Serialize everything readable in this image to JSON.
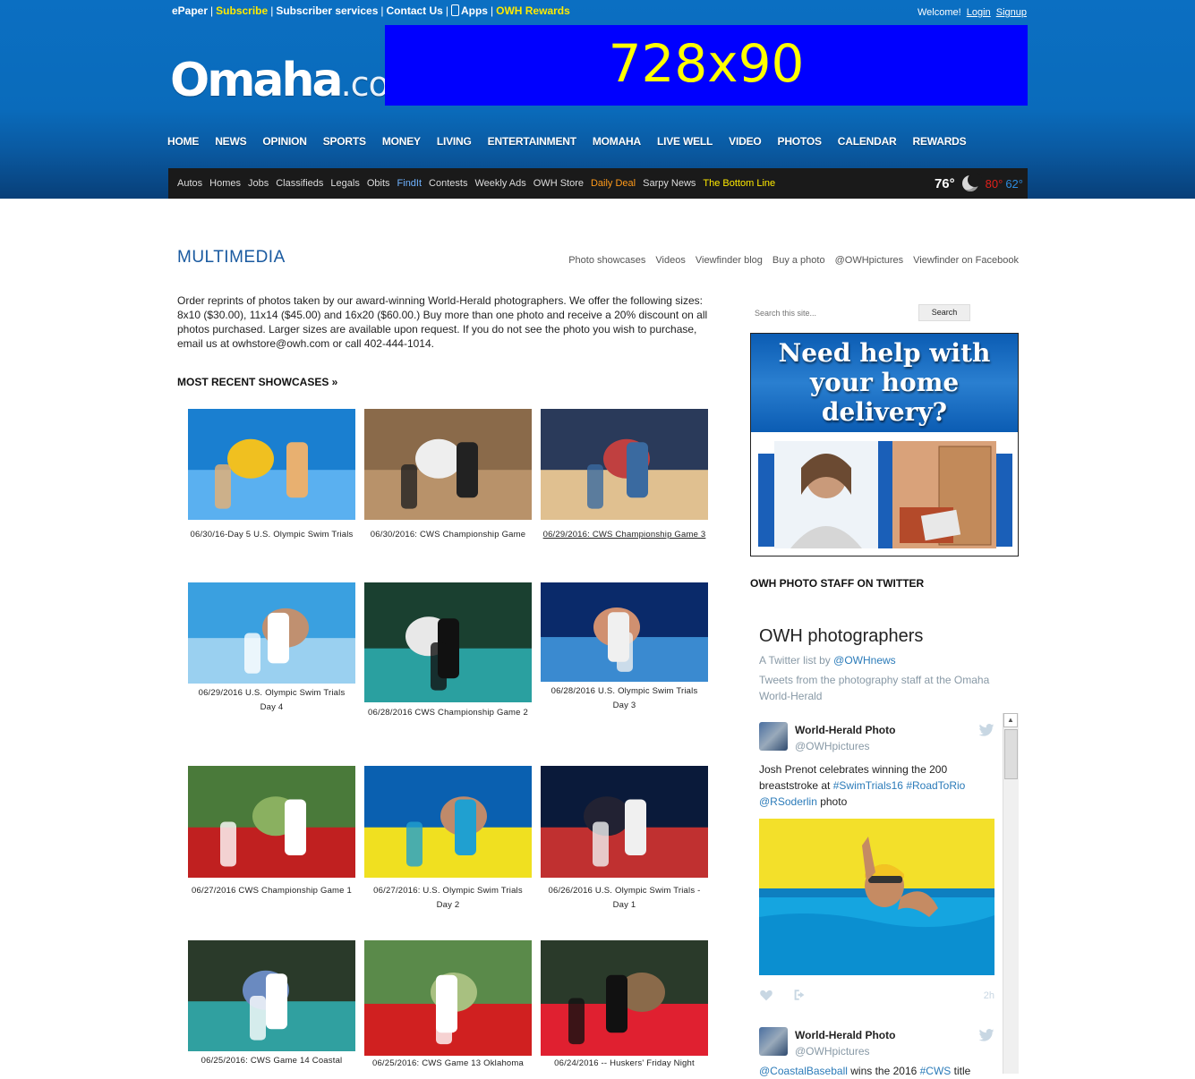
{
  "toplinks": {
    "epaper": "ePaper",
    "subscribe": "Subscribe",
    "subscriber_services": "Subscriber services",
    "contact": "Contact Us",
    "apps": "Apps",
    "rewards": "OWH Rewards"
  },
  "welcome": {
    "text": "Welcome!",
    "login": "Login",
    "signup": "Signup"
  },
  "logo": {
    "main": "Omaha",
    "dom": ".com"
  },
  "ad": {
    "text": "728x90"
  },
  "mainnav": [
    "HOME",
    "NEWS",
    "OPINION",
    "SPORTS",
    "MONEY",
    "LIVING",
    "ENTERTAINMENT",
    "MOMAHA",
    "LIVE WELL",
    "VIDEO",
    "PHOTOS",
    "CALENDAR",
    "REWARDS"
  ],
  "subnav": [
    "Autos",
    "Homes",
    "Jobs",
    "Classifieds",
    "Legals",
    "Obits",
    "FindIt",
    "Contests",
    "Weekly Ads",
    "OWH Store",
    "Daily Deal",
    "Sarpy News",
    "The Bottom Line"
  ],
  "subnav_colors": {
    "FindIt": "#6fb3ff",
    "Daily Deal": "#ff9a1a",
    "The Bottom Line": "#ffea00"
  },
  "weather": {
    "temp": "76°",
    "hi": "80°",
    "lo": "62°"
  },
  "section": {
    "title": "MULTIMEDIA",
    "links": [
      "Photo showcases",
      "Videos",
      "Viewfinder blog",
      "Buy a photo",
      "@OWHpictures",
      "Viewfinder on Facebook"
    ]
  },
  "intro": "Order reprints of photos taken by our award-winning World-Herald photographers. We offer the following sizes: 8x10 ($30.00), 11x14 ($45.00) and 16x20 ($60.00.) Buy more than one photo and receive a 20% discount on all photos purchased. Larger sizes are available upon request. If you do not see the photo you wish to purchase, email us at owhstore@owh.com or call 402-444-1014.",
  "recent_label": "MOST RECENT SHOWCASES »",
  "showcases": [
    {
      "caption": "06/30/16-Day 5 U.S. Olympic Swim Trials"
    },
    {
      "caption": "06/30/2016: CWS Championship Game"
    },
    {
      "caption": "06/29/2016: CWS Championship Game 3"
    },
    {
      "caption": "06/29/2016 U.S. Olympic Swim Trials Day 4"
    },
    {
      "caption": "06/28/2016 CWS Championship Game 2"
    },
    {
      "caption": "06/28/2016 U.S. Olympic Swim Trials Day 3"
    },
    {
      "caption": "06/27/2016 CWS Championship Game 1"
    },
    {
      "caption": "06/27/2016: U.S. Olympic Swim Trials Day 2"
    },
    {
      "caption": "06/26/2016 U.S. Olympic Swim Trials - Day 1"
    },
    {
      "caption": "06/25/2016: CWS Game 14 Coastal"
    },
    {
      "caption": "06/25/2016: CWS Game 13 Oklahoma"
    },
    {
      "caption": "06/24/2016 -- Huskers' Friday Night"
    }
  ],
  "search": {
    "placeholder": "Search this site...",
    "button": "Search"
  },
  "promo": {
    "headline": "Need help with your home delivery?"
  },
  "twitter": {
    "section_title": "OWH PHOTO STAFF ON TWITTER",
    "list_title": "OWH photographers",
    "by_prefix": "A Twitter list by ",
    "by_handle": "@OWHnews",
    "description": "Tweets from the photography staff at the Omaha World-Herald",
    "tweets": [
      {
        "name": "World-Herald Photo",
        "handle": "@OWHpictures",
        "text_pre": "Josh Prenot celebrates winning the 200 breaststroke at ",
        "tag1": "#SwimTrials16",
        "tag2": "#RoadToRio",
        "mention": "@RSoderlin",
        "text_post": " photo",
        "time": "2h"
      },
      {
        "name": "World-Herald Photo",
        "handle": "@OWHpictures",
        "mention": "@CoastalBaseball",
        "text_mid": " wins the 2016 ",
        "tag": "#CWS",
        "text_post": " title"
      }
    ]
  }
}
